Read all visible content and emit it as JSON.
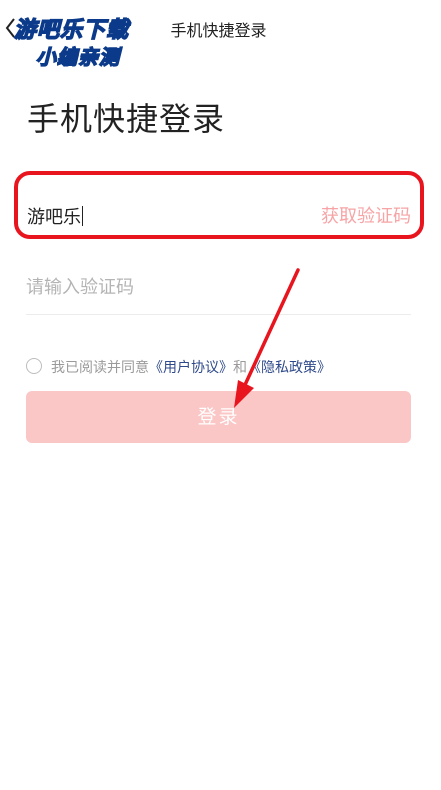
{
  "header": {
    "title": "手机快捷登录",
    "back_icon": "chevron-left-icon"
  },
  "watermark": {
    "line1": "游吧乐下载",
    "line2": "小编亲测"
  },
  "page_title": "手机快捷登录",
  "phone": {
    "value": "游吧乐",
    "get_code_label": "获取验证码"
  },
  "code": {
    "placeholder": "请输入验证码",
    "value": ""
  },
  "agreement": {
    "prefix": "我已阅读并同意",
    "user_agreement": "《用户协议》",
    "and": "和",
    "privacy_policy": "《隐私政策》"
  },
  "login_button": {
    "label": "登录"
  },
  "colors": {
    "accent": "#fbc6c6",
    "get_code": "#f6a4a6",
    "annotation_red": "#e8141e",
    "link": "#2f4a8a"
  }
}
